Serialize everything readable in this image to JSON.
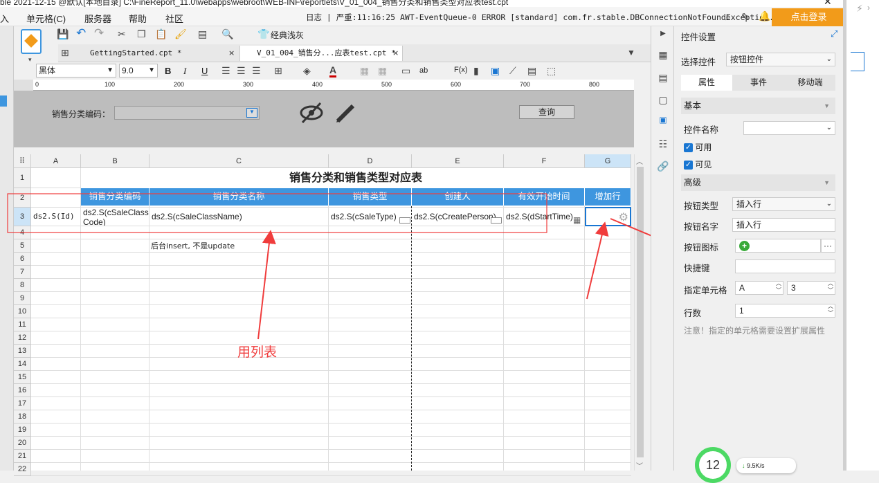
{
  "titlebar": {
    "text": "ble 2021-12-15 @默认[本地目录]    C:\\FineReport_11.0\\webapps\\webroot\\WEB-INF\\reportlets\\V_01_004_销售分类和销售类型对应表test.cpt"
  },
  "menu": {
    "items": [
      "入",
      "单元格(C)",
      "服务器",
      "帮助",
      "社区"
    ]
  },
  "logbar": {
    "text": "日志 | 严重:11:16:25 AWT-EventQueue-0 ERROR [standard] com.fr.stable.DBConnectionNotFoundExceptio..."
  },
  "login": {
    "label": "点击登录"
  },
  "toolbar": {
    "classic_label": "经典浅灰"
  },
  "tabs": [
    {
      "label": "GettingStarted.cpt *",
      "close": "×"
    },
    {
      "label": "V_01_004_销售分...应表test.cpt *",
      "close": "×"
    }
  ],
  "format": {
    "font": "黑体",
    "size": "9.0",
    "bold": "B",
    "italic": "I",
    "underline": "U",
    "fx": "F(x)",
    "ab": "ab"
  },
  "ruler": {
    "ticks": [
      "0",
      "100",
      "200",
      "300",
      "400",
      "500",
      "600",
      "700",
      "800"
    ]
  },
  "param": {
    "label": "销售分类编码：",
    "query": "查询"
  },
  "sheet": {
    "columns": [
      "A",
      "B",
      "C",
      "D",
      "E",
      "F",
      "G"
    ],
    "rows": [
      "1",
      "2",
      "3",
      "4",
      "5",
      "6",
      "7",
      "8",
      "9",
      "10",
      "11",
      "12",
      "13",
      "14",
      "15",
      "16",
      "17",
      "18",
      "19",
      "20",
      "21",
      "22"
    ],
    "title": "销售分类和销售类型对应表",
    "headers": [
      "销售分类编码",
      "销售分类名称",
      "销售类型",
      "创建人",
      "有效开始时间",
      "增加行"
    ],
    "row3": [
      "ds2.S(Id)",
      "ds2.S(cSaleClassCode)",
      "ds2.S(cSaleClassName)",
      "ds2.S(cSaleType)",
      "ds2.S(cCreatePerson)",
      "ds2.S(dStartTime)"
    ],
    "note": "后台insert, 不是update"
  },
  "annotation": {
    "text": "用列表",
    "color": "#f03c3c"
  },
  "panel": {
    "title": "控件设置",
    "select_label": "选择控件",
    "select_value": "按钮控件",
    "tabs": [
      "属性",
      "事件",
      "移动端"
    ],
    "basic": "基本",
    "name_label": "控件名称",
    "name_value": "",
    "enabled": "可用",
    "visible": "可见",
    "advanced": "高级",
    "btn_type_label": "按钮类型",
    "btn_type_value": "插入行",
    "btn_name_label": "按钮名字",
    "btn_name_value": "插入行",
    "btn_icon_label": "按钮图标",
    "shortcut_label": "快捷键",
    "cell_label": "指定单元格",
    "cell_col": "A",
    "cell_row": "3",
    "rows_label": "行数",
    "rows_value": "1",
    "note": "注意！指定的单元格需要设置扩展属性"
  },
  "netspeed": {
    "value": "9.5K/s",
    "badge": "12"
  },
  "colors": {
    "header_blue": "#3e96df",
    "accent_orange": "#f29b1a",
    "annotation_red": "#f03c3c"
  }
}
